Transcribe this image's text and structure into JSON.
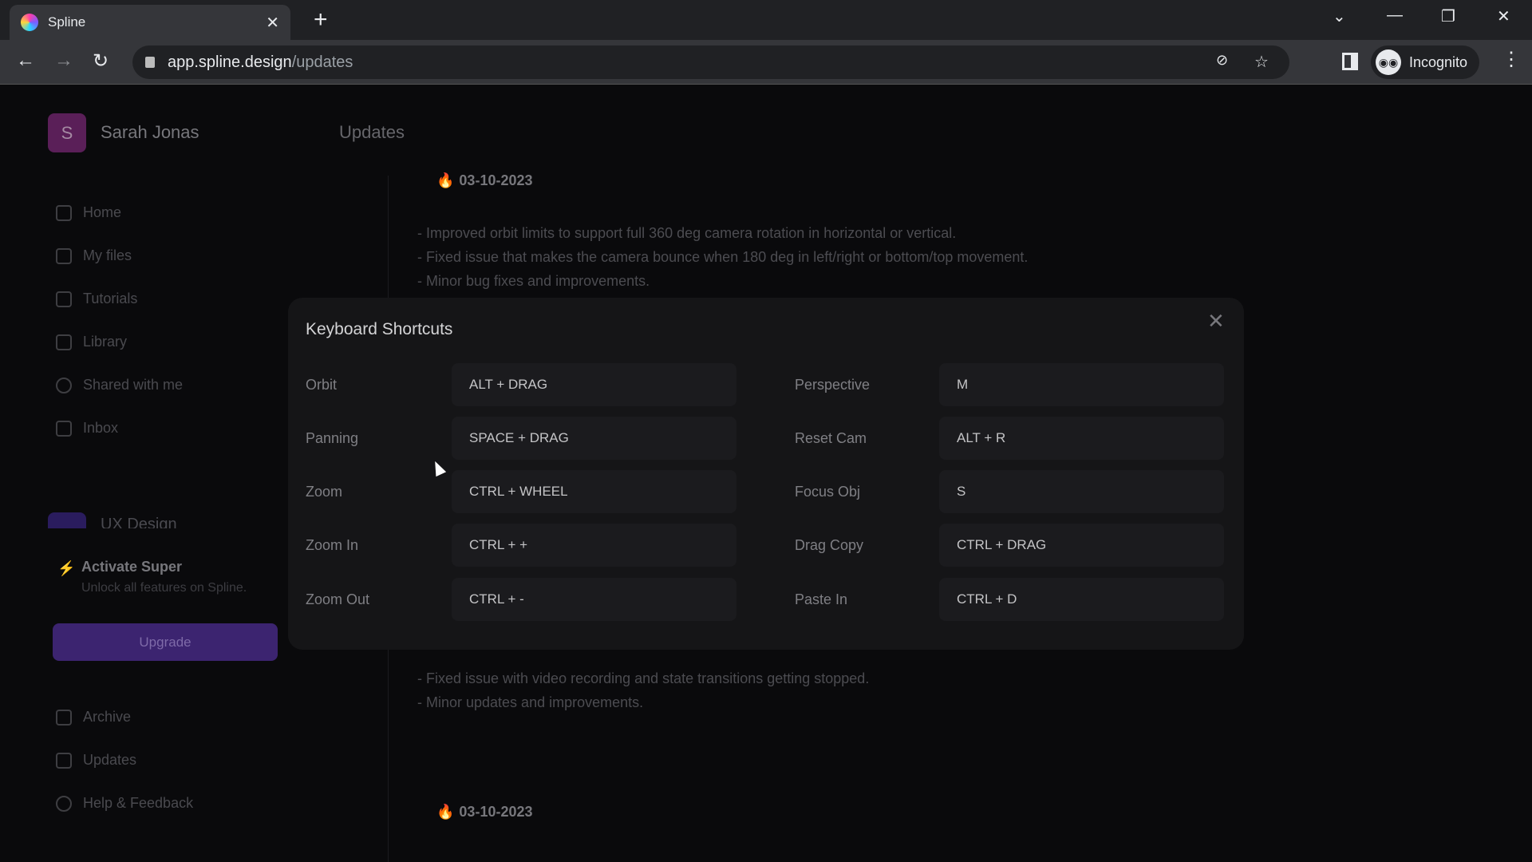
{
  "browser": {
    "tab_title": "Spline",
    "url_host": "app.spline.design",
    "url_path": "/updates",
    "profile": "Incognito"
  },
  "user": {
    "initial": "S",
    "name": "Sarah Jonas"
  },
  "header": {
    "title": "Updates"
  },
  "sidebar": {
    "items": [
      {
        "label": "Home",
        "icon": "home-icon"
      },
      {
        "label": "My files",
        "icon": "pencil-icon"
      },
      {
        "label": "Tutorials",
        "icon": "book-icon"
      },
      {
        "label": "Library",
        "icon": "library-icon"
      },
      {
        "label": "Shared with me",
        "icon": "user-circle-icon"
      },
      {
        "label": "Inbox",
        "icon": "bell-icon"
      }
    ],
    "team": {
      "initial": "U",
      "name": "UX Design"
    },
    "promo": {
      "title": "Activate Super",
      "subtitle": "Unlock all features on Spline.",
      "button": "Upgrade"
    },
    "bottom": [
      {
        "label": "Archive",
        "icon": "trash-icon"
      },
      {
        "label": "Updates",
        "icon": "star-icon"
      },
      {
        "label": "Help & Feedback",
        "icon": "help-icon"
      }
    ]
  },
  "updates": [
    {
      "date": "03-10-2023",
      "notes": [
        "- Improved orbit limits to support full 360 deg camera rotation in horizontal or vertical.",
        "- Fixed issue that makes the camera bounce when 180 deg in left/right or bottom/top movement.",
        "- Minor bug fixes and improvements."
      ]
    },
    {
      "notes": [
        "- Fixed issue with video recording and state transitions getting stopped.",
        "- Minor updates and improvements."
      ]
    },
    {
      "date": "03-10-2023"
    }
  ],
  "modal": {
    "title": "Keyboard Shortcuts",
    "left": [
      {
        "label": "Orbit",
        "keys": "ALT + DRAG"
      },
      {
        "label": "Panning",
        "keys": "SPACE + DRAG"
      },
      {
        "label": "Zoom",
        "keys": "CTRL + WHEEL"
      },
      {
        "label": "Zoom In",
        "keys": "CTRL + +"
      },
      {
        "label": "Zoom Out",
        "keys": "CTRL + -"
      }
    ],
    "right": [
      {
        "label": "Perspective",
        "keys": "M"
      },
      {
        "label": "Reset Cam",
        "keys": "ALT + R"
      },
      {
        "label": "Focus Obj",
        "keys": "S"
      },
      {
        "label": "Drag Copy",
        "keys": "CTRL + DRAG"
      },
      {
        "label": "Paste In",
        "keys": "CTRL + D"
      }
    ]
  },
  "colors": {
    "accent": "#3c2470",
    "avatar": "#5a1f58",
    "modal_bg": "#151517"
  }
}
